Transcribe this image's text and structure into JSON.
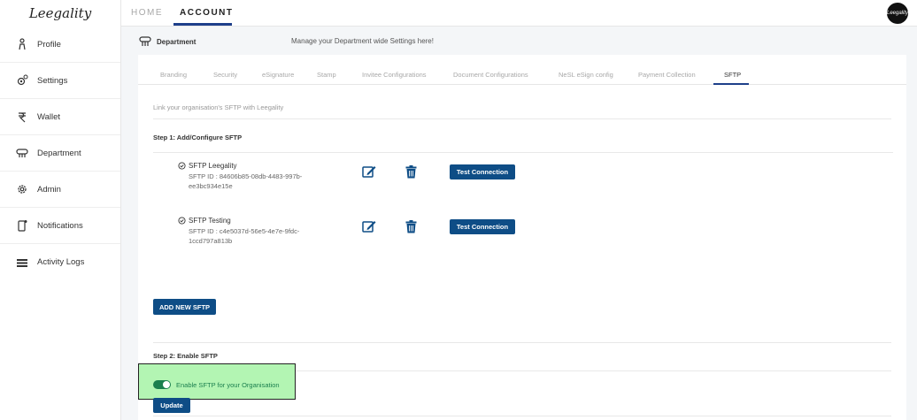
{
  "sidebar": {
    "logo": "Leegality",
    "items": [
      {
        "label": "Profile",
        "icon": "person-icon"
      },
      {
        "label": "Settings",
        "icon": "gear-icon"
      },
      {
        "label": "Wallet",
        "icon": "rupee-icon"
      },
      {
        "label": "Department",
        "icon": "department-icon"
      },
      {
        "label": "Admin",
        "icon": "admin-gear-icon"
      },
      {
        "label": "Notifications",
        "icon": "phone-bell-icon"
      },
      {
        "label": "Activity Logs",
        "icon": "list-icon"
      }
    ]
  },
  "topbar": {
    "home": "HOME",
    "account": "ACCOUNT",
    "avatar_text": "Leegality"
  },
  "header": {
    "title": "Department",
    "subtitle": "Manage your Department wide Settings here!"
  },
  "tabs": [
    "Branding",
    "Security",
    "eSignature",
    "Stamp",
    "Invitee Configurations",
    "Document Configurations",
    "NeSL eSign config",
    "Payment Collection",
    "SFTP"
  ],
  "active_tab": "SFTP",
  "content": {
    "link_text": "Link your organisation's SFTP with Leegality",
    "step1_title": "Step 1: Add/Configure SFTP",
    "sftps": [
      {
        "name": "SFTP Leegality",
        "id": "SFTP ID : 84606b85-08db-4483-997b-ee3bc934e15e",
        "button": "Test Connection"
      },
      {
        "name": "SFTP Testing",
        "id": "SFTP ID : c4e5037d-56e5-4e7e-9fdc-1ccd797a813b",
        "button": "Test Connection"
      }
    ],
    "add_button": "ADD NEW SFTP",
    "step2_title": "Step 2: Enable SFTP",
    "toggle_label": "Enable SFTP for your Organisation",
    "toggle_on": true,
    "update_button": "Update"
  },
  "colors": {
    "accent": "#0e4d86",
    "toggle": "#1b7f4e",
    "highlight": "#b3f5b3"
  }
}
